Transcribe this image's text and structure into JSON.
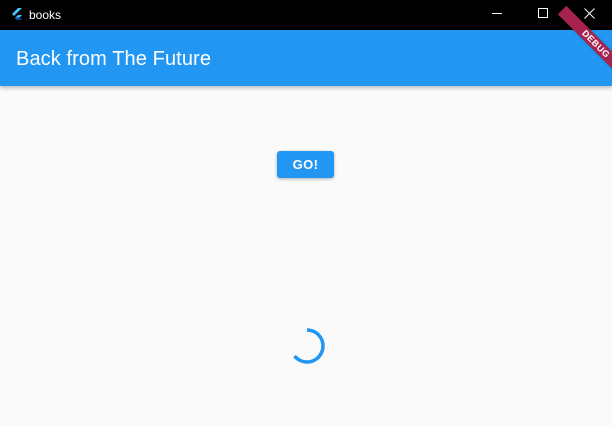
{
  "window": {
    "title": "books",
    "icons": {
      "app": "flutter-logo-icon",
      "minimize": "minimize-icon",
      "maximize": "maximize-icon",
      "close": "close-icon"
    }
  },
  "appbar": {
    "title": "Back from The Future"
  },
  "debug_banner": {
    "label": "DEBUG"
  },
  "main": {
    "go_button_label": "GO!",
    "loading_indicator": "progress-spinner-icon"
  },
  "colors": {
    "primary": "#2196f3",
    "title_bar": "#000000",
    "background": "#fafafa",
    "debug_banner": "#a6234d"
  }
}
